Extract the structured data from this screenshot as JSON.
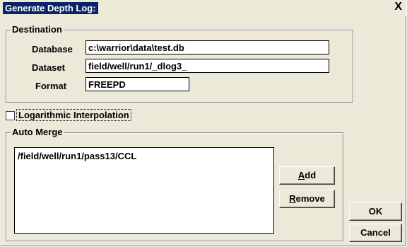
{
  "window": {
    "title": "Generate Depth Log:",
    "close_glyph": "X"
  },
  "destination": {
    "legend": "Destination",
    "database_label": "Database",
    "database_value": "c:\\warrior\\data\\test.db",
    "dataset_label": "Dataset",
    "dataset_value": "field/well/run1/_dlog3_",
    "format_label": "Format",
    "format_value": "FREEPD"
  },
  "log_interpolation": {
    "label": "Logarithmic Interpolation",
    "checked": false
  },
  "auto_merge": {
    "legend": "Auto Merge",
    "items": [
      "/field/well/run1/pass13/CCL"
    ],
    "add_first": "A",
    "add_rest": "dd",
    "remove_first": "R",
    "remove_rest": "emove"
  },
  "buttons": {
    "ok": "OK",
    "cancel": "Cancel"
  }
}
